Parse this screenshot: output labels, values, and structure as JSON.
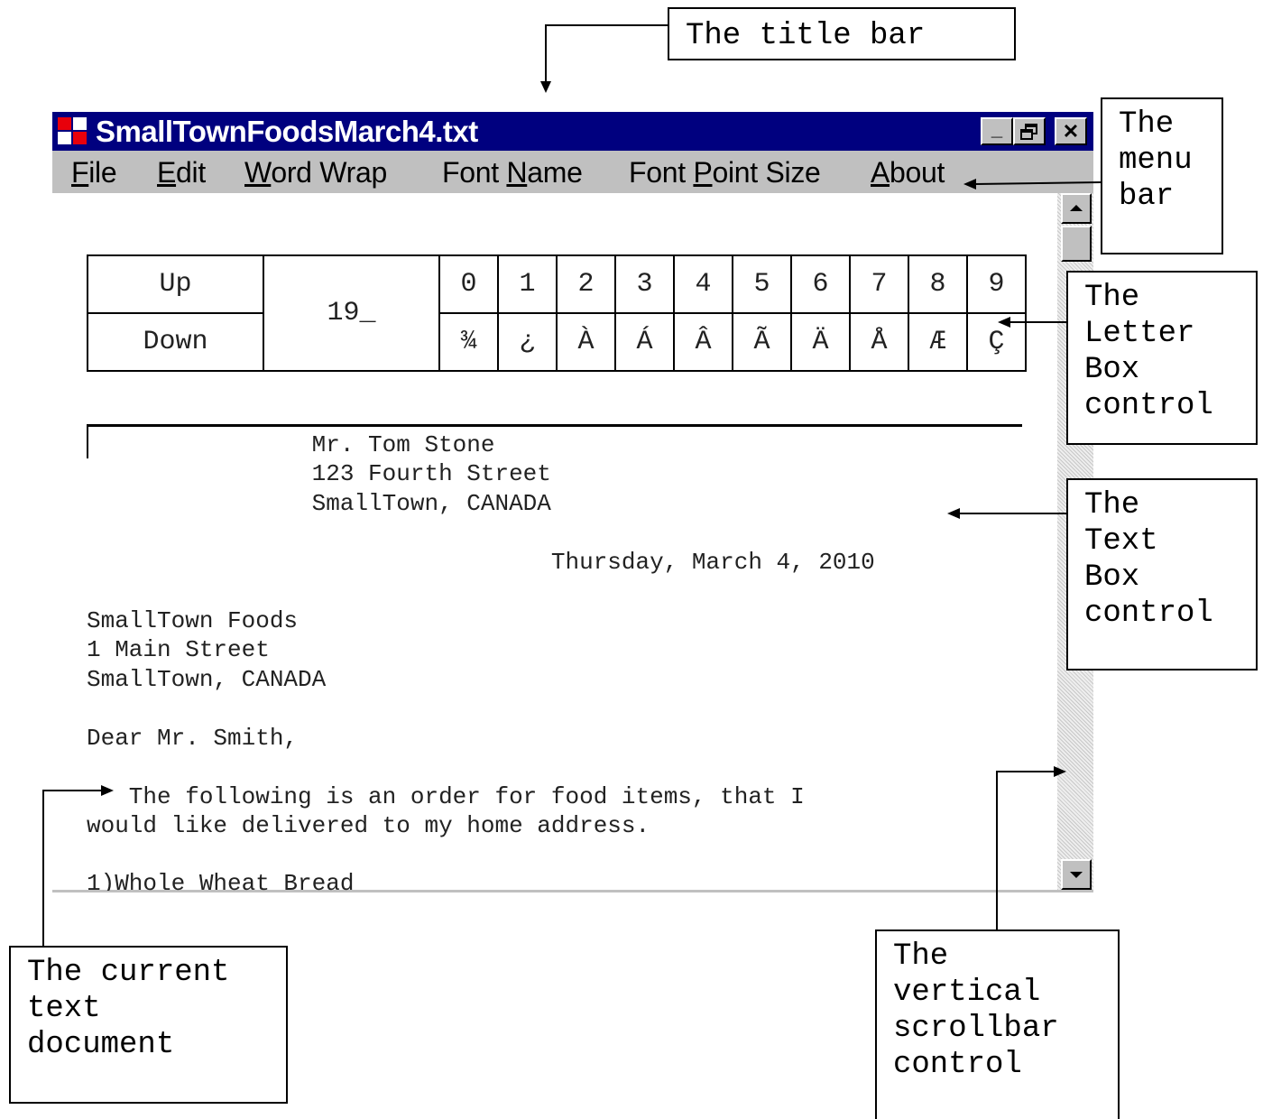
{
  "window": {
    "title": "SmallTownFoodsMarch4.txt",
    "buttons": {
      "minimize": "_",
      "maximize": "🗗",
      "close": "✕"
    }
  },
  "menubar": {
    "items": [
      {
        "label": "File",
        "mnemonic": "F"
      },
      {
        "label": "Edit",
        "mnemonic": "E"
      },
      {
        "label": "Word Wrap",
        "mnemonic": "W"
      },
      {
        "label": "Font Name",
        "mnemonic": "N"
      },
      {
        "label": "Font Point Size",
        "mnemonic": "P"
      },
      {
        "label": "About",
        "mnemonic": "A"
      }
    ]
  },
  "letter_box": {
    "up_label": "Up",
    "down_label": "Down",
    "center_value": "19_",
    "top_row": [
      "0",
      "1",
      "2",
      "3",
      "4",
      "5",
      "6",
      "7",
      "8",
      "9"
    ],
    "bottom_row": [
      "¾",
      "¿",
      "À",
      "Á",
      "Â",
      "Ã",
      "Ä",
      "Å",
      "Æ",
      "Ç"
    ]
  },
  "document": {
    "lines": [
      "                Mr. Tom Stone",
      "                123 Fourth Street",
      "                SmallTown, CANADA",
      "",
      "                                 Thursday, March 4, 2010",
      "",
      "SmallTown Foods",
      "1 Main Street",
      "SmallTown, CANADA",
      "",
      "Dear Mr. Smith,",
      "",
      "   The following is an order for food items, that I",
      "would like delivered to my home address.",
      "",
      "1)Whole Wheat Bread"
    ]
  },
  "callouts": {
    "title_bar": "The title bar",
    "menu_bar": "The\nmenu\nbar",
    "letter_box": "The\nLetter\nBox\ncontrol",
    "text_box": "The\nText\nBox\ncontrol",
    "current_doc": "The current\ntext\ndocument",
    "scrollbar": "The\nvertical\nscrollbar\ncontrol"
  },
  "colors": {
    "titlebar": "#00007f",
    "chrome": "#c0c0c0",
    "icon_red": "#e8000b"
  }
}
